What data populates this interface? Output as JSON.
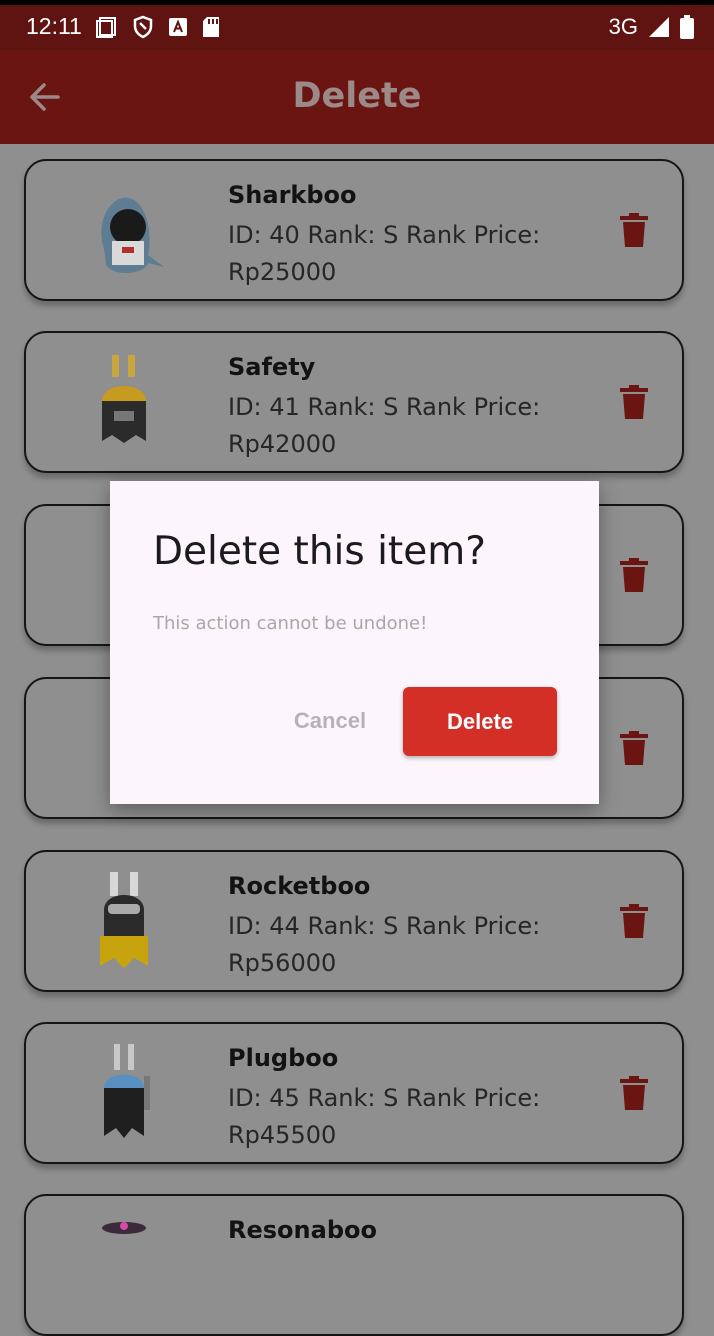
{
  "status_bar": {
    "time": "12:11",
    "network": "3G",
    "icons": [
      "screen-icon",
      "shield-icon",
      "a-badge-icon",
      "sd-card-icon",
      "signal-icon",
      "battery-icon"
    ]
  },
  "app_bar": {
    "title": "Delete",
    "back_icon": "back-arrow-icon"
  },
  "items": [
    {
      "name": "Sharkboo",
      "meta": "ID: 40 Rank: S Rank Price: Rp25000"
    },
    {
      "name": "Safety",
      "meta": "ID: 41 Rank: S Rank Price: Rp42000"
    },
    {
      "name": "",
      "meta": ""
    },
    {
      "name": "",
      "meta": ""
    },
    {
      "name": "Rocketboo",
      "meta": "ID: 44 Rank: S Rank Price: Rp56000"
    },
    {
      "name": "Plugboo",
      "meta": "ID: 45 Rank: S Rank Price: Rp45500"
    },
    {
      "name": "Resonaboo",
      "meta": ""
    }
  ],
  "dialog": {
    "title": "Delete this item?",
    "message": "This action cannot be undone!",
    "cancel_label": "Cancel",
    "delete_label": "Delete"
  },
  "colors": {
    "app_bar": "#6b1512",
    "trash": "#6b1512",
    "delete_button": "#d42f27",
    "background_dimmed": "#8f8f8f"
  }
}
